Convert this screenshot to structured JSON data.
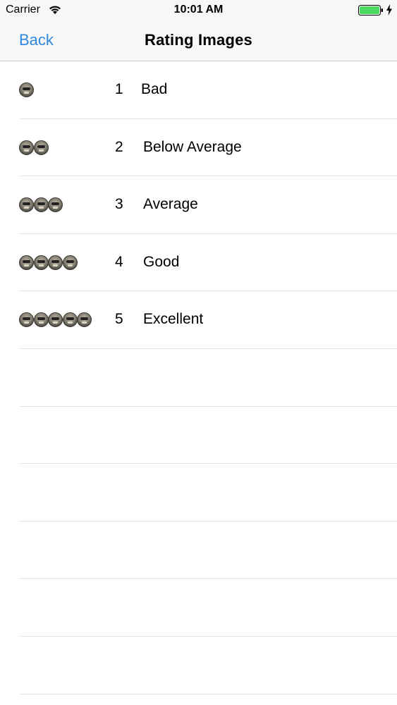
{
  "status_bar": {
    "carrier": "Carrier",
    "time": "10:01 AM",
    "battery_color": "#4cd964"
  },
  "nav": {
    "back_label": "Back",
    "title": "Rating Images",
    "accent_color": "#2d88e0"
  },
  "rows": [
    {
      "icon_count": 1,
      "number": "1",
      "label": "Bad"
    },
    {
      "icon_count": 2,
      "number": "2",
      "label": "Below Average"
    },
    {
      "icon_count": 3,
      "number": "3",
      "label": "Average"
    },
    {
      "icon_count": 4,
      "number": "4",
      "label": "Good"
    },
    {
      "icon_count": 5,
      "number": "5",
      "label": "Excellent"
    }
  ],
  "rating_icon": "coin-face-icon"
}
